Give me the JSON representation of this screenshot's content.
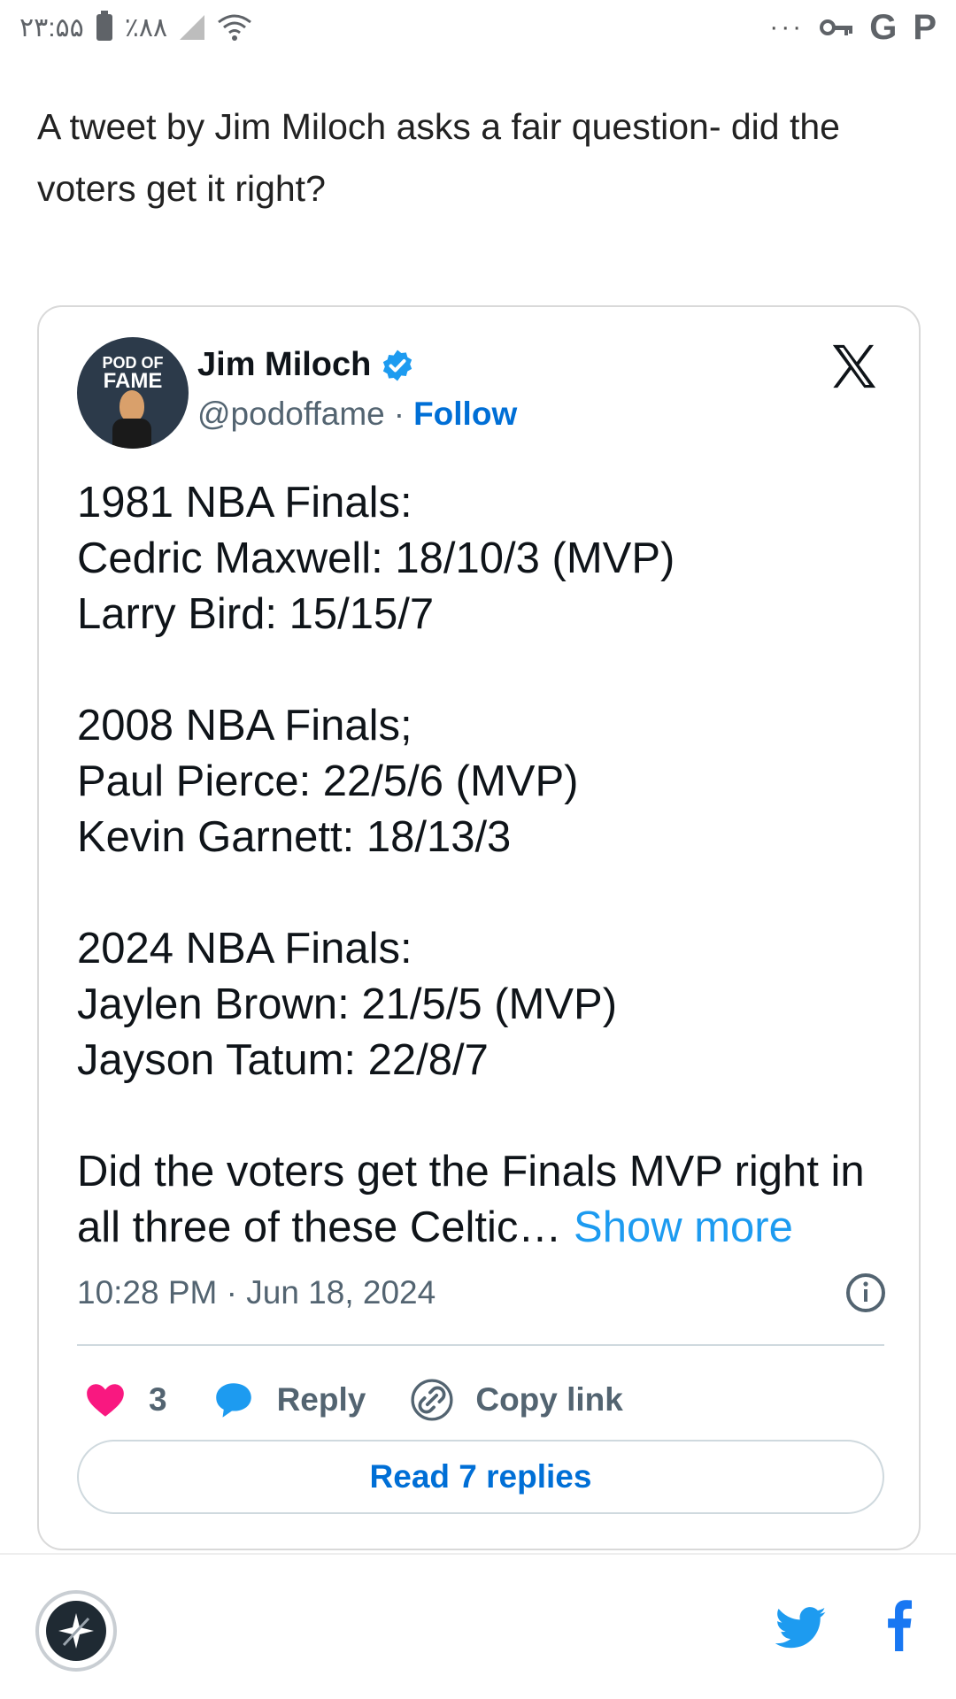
{
  "status_bar": {
    "time": "۲۳:۵۵",
    "battery": "٪۸۸",
    "more": "···",
    "g_label": "G",
    "p_label": "P"
  },
  "article": {
    "intro": "A tweet by Jim Miloch asks a fair question- did the voters get it right?"
  },
  "tweet": {
    "avatar_text_top": "POD OF",
    "avatar_text_bottom": "FAME",
    "author": "Jim Miloch",
    "handle": "@podoffame",
    "separator": "·",
    "follow": "Follow",
    "paragraphs": [
      "1981 NBA Finals:\nCedric Maxwell: 18/10/3 (MVP)\nLarry Bird: 15/15/7",
      "2008 NBA Finals;\nPaul Pierce: 22/5/6 (MVP)\nKevin Garnett: 18/13/3",
      "2024 NBA Finals:\nJaylen Brown: 21/5/5 (MVP)\nJayson Tatum: 22/8/7"
    ],
    "last_paragraph": "Did the voters get the Finals MVP right in all three of these Celtic…",
    "show_more": "Show more",
    "timestamp": "10:28 PM · Jun 18, 2024",
    "likes": "3",
    "reply": "Reply",
    "copy_link": "Copy link",
    "read_replies": "Read 7 replies"
  },
  "colors": {
    "link": "#006fd6",
    "show_more": "#1d9bf0",
    "like": "#f91880",
    "reply_bubble": "#1d9bf0",
    "twitter": "#1d9bf0",
    "facebook": "#1877f2"
  }
}
